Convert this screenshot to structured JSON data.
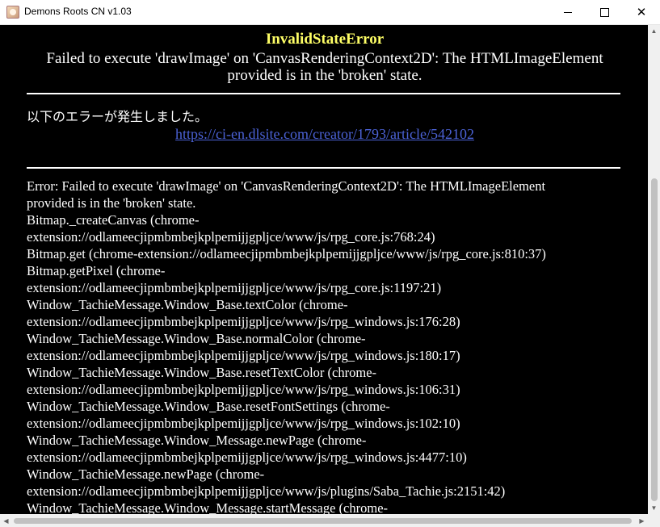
{
  "window": {
    "title": "Demons Roots CN v1.03",
    "controls": {
      "minimize": "minimize-icon",
      "maximize": "maximize-icon",
      "close": "close-icon"
    }
  },
  "error": {
    "name": "InvalidStateError",
    "message": "Failed to execute 'drawImage' on 'CanvasRenderingContext2D': The HTMLImageElement provided is in the 'broken' state.",
    "notice": "以下のエラーが発生しました。",
    "link": "https://ci-en.dlsite.com/creator/1793/article/542102",
    "stack_lines": [
      "Error: Failed to execute 'drawImage' on 'CanvasRenderingContext2D': The HTMLImageElement",
      "provided is in the 'broken' state.",
      "Bitmap._createCanvas (chrome-",
      "extension://odlameecjipmbmbejkplpemijjgpljce/www/js/rpg_core.js:768:24)",
      "Bitmap.get (chrome-extension://odlameecjipmbmbejkplpemijjgpljce/www/js/rpg_core.js:810:37)",
      "Bitmap.getPixel (chrome-",
      "extension://odlameecjipmbmbejkplpemijjgpljce/www/js/rpg_core.js:1197:21)",
      "Window_TachieMessage.Window_Base.textColor (chrome-",
      "extension://odlameecjipmbmbejkplpemijjgpljce/www/js/rpg_windows.js:176:28)",
      "Window_TachieMessage.Window_Base.normalColor (chrome-",
      "extension://odlameecjipmbmbejkplpemijjgpljce/www/js/rpg_windows.js:180:17)",
      "Window_TachieMessage.Window_Base.resetTextColor (chrome-",
      "extension://odlameecjipmbmbejkplpemijjgpljce/www/js/rpg_windows.js:106:31)",
      "Window_TachieMessage.Window_Base.resetFontSettings (chrome-",
      "extension://odlameecjipmbmbejkplpemijjgpljce/www/js/rpg_windows.js:102:10)",
      "Window_TachieMessage.Window_Message.newPage (chrome-",
      "extension://odlameecjipmbmbejkplpemijjgpljce/www/js/rpg_windows.js:4477:10)",
      "Window_TachieMessage.newPage (chrome-",
      "extension://odlameecjipmbmbejkplpemijjgpljce/www/js/plugins/Saba_Tachie.js:2151:42)",
      "Window_TachieMessage.Window_Message.startMessage (chrome-"
    ]
  },
  "colors": {
    "background": "#000000",
    "error_name": "#ffff66",
    "link": "#4b62d6",
    "text": "#ffffff"
  }
}
